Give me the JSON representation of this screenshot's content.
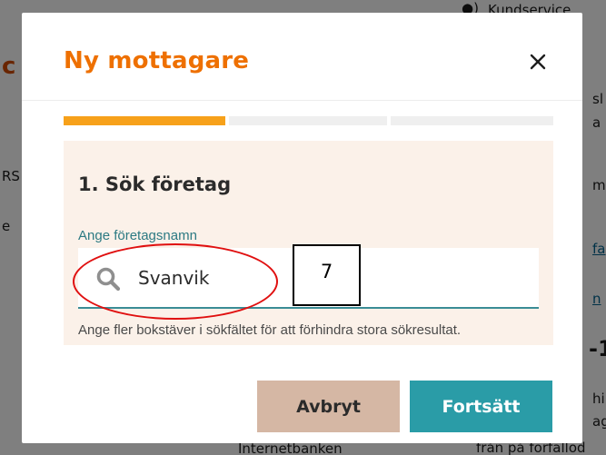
{
  "background": {
    "top_right": "Kundservice",
    "right_fragments": [
      "sl",
      "a",
      "m",
      "fa",
      "n",
      "-1",
      "hi",
      "ag"
    ],
    "bottom_center": "Internetbanken",
    "bottom_right": "från på förfallod",
    "left_fragments": [
      "c",
      "RS",
      "e"
    ]
  },
  "modal": {
    "title": "Ny mottagare",
    "close_label": "×",
    "progress": {
      "current_step": 1,
      "total_steps": 3
    },
    "step_title": "1. Sök företag",
    "field_label": "Ange företagsnamn",
    "search_value": "Svanvik",
    "helper_text": "Ange fler bokstäver i sökfältet för att förhindra stora sökresultat.",
    "cancel_label": "Avbryt",
    "continue_label": "Fortsätt"
  },
  "annotation": {
    "number": "7"
  },
  "colors": {
    "title_orange": "#ee7001",
    "progress_active": "#f7a11a",
    "panel_bg": "#fbf1e9",
    "teal": "#2a9ca7",
    "cancel_bg": "#d5b7a4",
    "annotation_red": "#e01010"
  }
}
